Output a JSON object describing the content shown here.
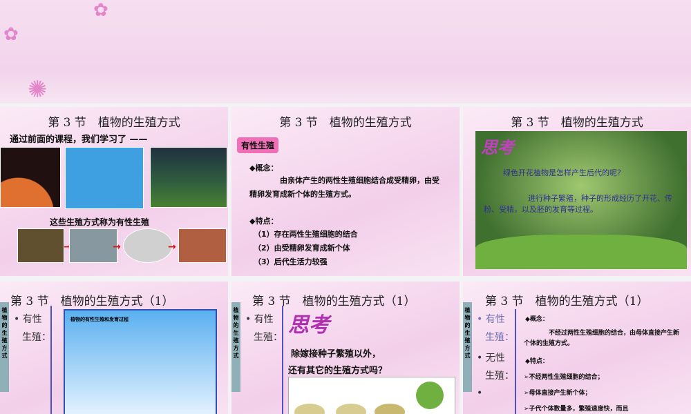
{
  "slides": [
    {
      "title": "第 3 节　植物的生殖方式",
      "intro": "通过前面的课程，我们学习了 ——",
      "caption": "这些生殖方式称为有性生殖"
    },
    {
      "title": "第 3 节　植物的生殖方式",
      "tag": "有性生殖",
      "concept_label": "◆概念：",
      "concept": "由亲体产生的两性生殖细胞结合成受精卵，由受精卵发育成新个体的生殖方式。",
      "feature_label": "◆特点：",
      "features": [
        "（1）存在两性生殖细胞的结合",
        "（2）由受精卵发育成新个体",
        "（3）后代生活力较强"
      ]
    },
    {
      "title": "第 3 节　植物的生殖方式",
      "think": "思考",
      "question": "绿色开花植物是怎样产生后代的呢？",
      "answer": "进行种子繁殖，种子的形成经历了开花、传粉、受精，以及胚的发育等过程。"
    },
    {
      "title": "第 3 节　植物的生殖方式（1）",
      "side": "植物的生殖方式",
      "bullet1a": "• 有性",
      "bullet1b": "生殖：",
      "box_title": "植物的有性生殖和发育过程"
    },
    {
      "title": "第 3 节　植物的生殖方式（1）",
      "side": "植物的生殖方式",
      "bullet1a": "• 有性",
      "bullet1b": "生殖：",
      "think": "思考",
      "q1": "除嫁接种子繁殖以外，",
      "q2": "还有其它的生殖方式吗？"
    },
    {
      "title": "第 3 节　植物的生殖方式（1）",
      "side": "植物的生殖方式",
      "bullet1a": "• 有性",
      "bullet1b": "生殖：",
      "bullet2a": "• 无性",
      "bullet2b": "生殖：",
      "bullet3": "•",
      "concept_label": "◆概念：",
      "concept": "不经过两性生殖细胞的结合，由母体直接产生新个体的生殖方式。",
      "feature_label": "◆特点：",
      "features": [
        "➢不经两性生殖细胞的结合；",
        "➢母体直接产生新个体；",
        "➢子代个体数量多，繁殖速度快，而且"
      ]
    }
  ]
}
